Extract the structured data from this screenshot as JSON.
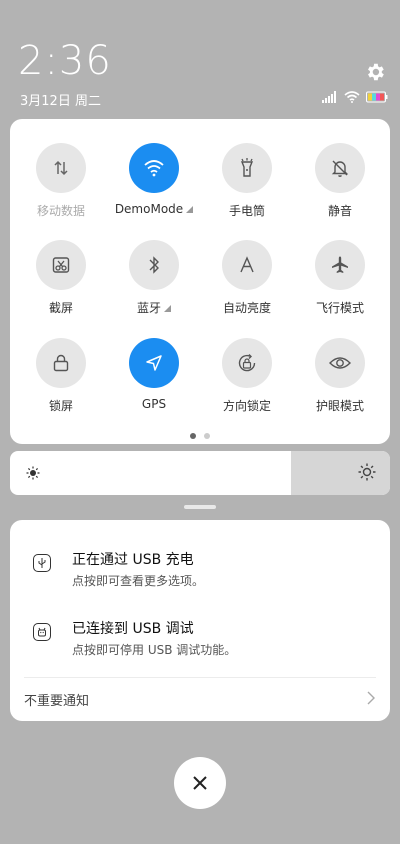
{
  "status": {
    "time": "2:36",
    "date": "3月12日 周二"
  },
  "quick_settings": {
    "tiles": [
      {
        "label": "移动数据",
        "icon": "mobile-data-icon",
        "active": false,
        "dim": true
      },
      {
        "label": "DemoMode",
        "icon": "wifi-icon",
        "active": true,
        "more": true
      },
      {
        "label": "手电筒",
        "icon": "flashlight-icon",
        "active": false
      },
      {
        "label": "静音",
        "icon": "mute-bell-icon",
        "active": false
      },
      {
        "label": "截屏",
        "icon": "screenshot-icon",
        "active": false
      },
      {
        "label": "蓝牙",
        "icon": "bluetooth-icon",
        "active": false,
        "more": true
      },
      {
        "label": "自动亮度",
        "icon": "auto-brightness-icon",
        "active": false
      },
      {
        "label": "飞行模式",
        "icon": "airplane-icon",
        "active": false
      },
      {
        "label": "锁屏",
        "icon": "lock-icon",
        "active": false
      },
      {
        "label": "GPS",
        "icon": "location-arrow-icon",
        "active": true
      },
      {
        "label": "方向锁定",
        "icon": "rotation-lock-icon",
        "active": false
      },
      {
        "label": "护眼模式",
        "icon": "eye-icon",
        "active": false
      }
    ],
    "page_count": 2,
    "current_page": 0
  },
  "brightness": {
    "level": 0.74
  },
  "notifications": [
    {
      "title": "正在通过 USB 充电",
      "body": "点按即可查看更多选项。",
      "icon": "usb-icon"
    },
    {
      "title": "已连接到 USB 调试",
      "body": "点按即可停用 USB 调试功能。",
      "icon": "android-debug-icon"
    }
  ],
  "unimportant_label": "不重要通知",
  "colors": {
    "accent": "#1b8df1",
    "background": "#b3b3b3"
  }
}
